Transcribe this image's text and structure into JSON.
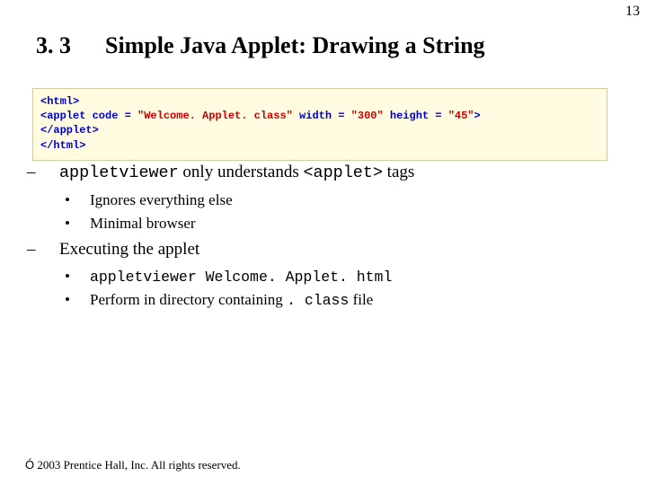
{
  "page_number": "13",
  "heading": {
    "number": "3. 3",
    "title": "Simple Java Applet: Drawing a String"
  },
  "code": {
    "l1_open": "<html>",
    "l2_a": "<applet code = ",
    "l2_str": "\"Welcome. Applet. class\"",
    "l2_b": " width = ",
    "l2_w": "\"300\"",
    "l2_c": " height = ",
    "l2_h": "\"45\"",
    "l2_end": ">",
    "l3": "</applet>",
    "l4": "</html>"
  },
  "bullets": {
    "b1_pre": "appletviewer",
    "b1_mid": " only understands ",
    "b1_tag": "<applet>",
    "b1_post": " tags",
    "b1_1": "Ignores everything else",
    "b1_2": "Minimal browser",
    "b2": "Executing the applet",
    "b2_1": "appletviewer Welcome. Applet. html",
    "b2_2a": "Perform in directory containing ",
    "b2_2code": ". class",
    "b2_2b": " file"
  },
  "footer": "2003 Prentice Hall, Inc. All rights reserved."
}
